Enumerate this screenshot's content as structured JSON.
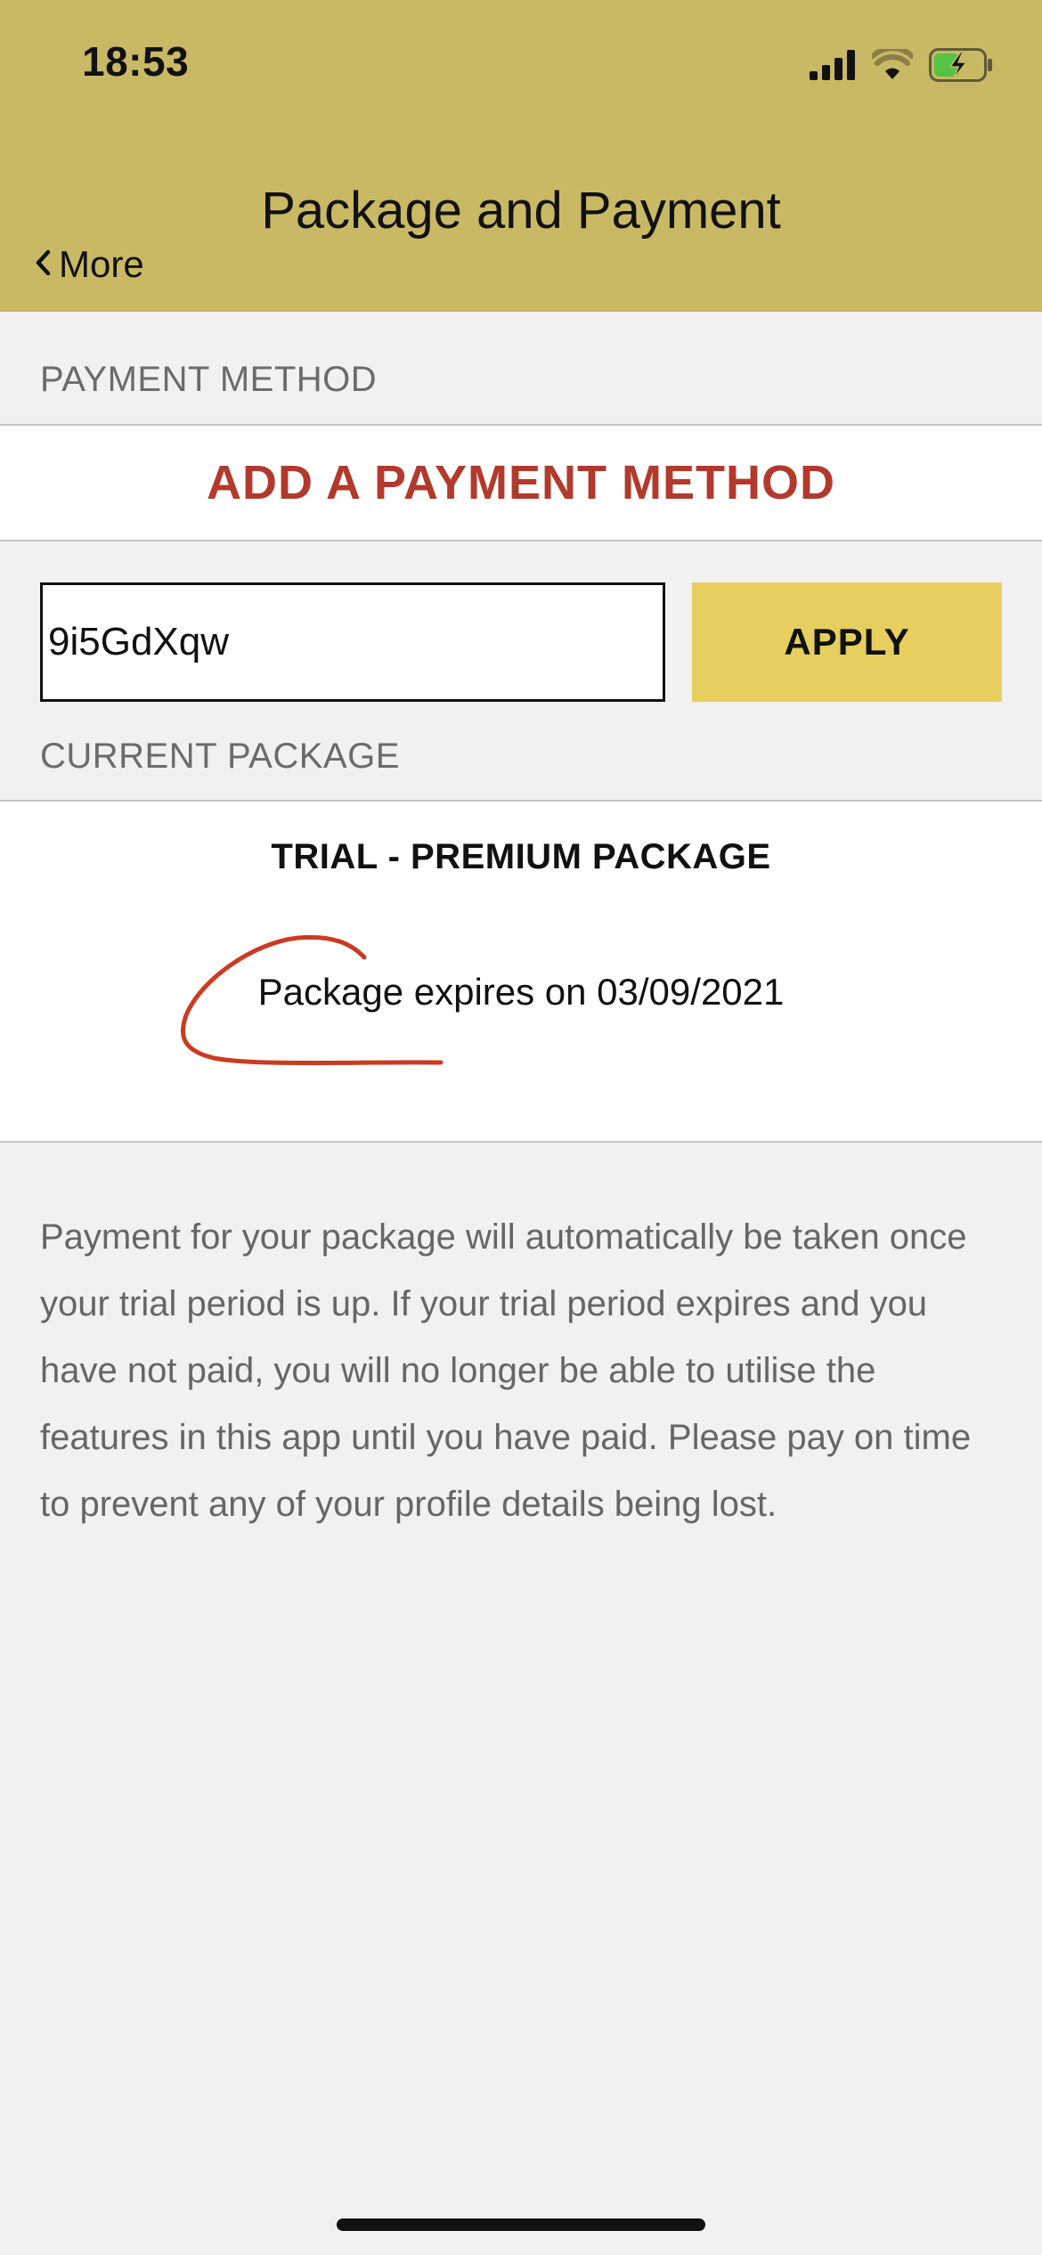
{
  "status_bar": {
    "time": "18:53",
    "icons": [
      "signal-icon",
      "wifi-icon",
      "battery-charging-icon"
    ]
  },
  "nav": {
    "title": "Package and Payment",
    "back_label": "More"
  },
  "payment": {
    "section_label": "PAYMENT METHOD",
    "add_label": "ADD A PAYMENT METHOD",
    "promo_code_value": "9i5GdXqw",
    "apply_label": "APPLY"
  },
  "package": {
    "section_label": "CURRENT PACKAGE",
    "name": "TRIAL - PREMIUM PACKAGE",
    "expiry": "Package expires on 03/09/2021"
  },
  "info": {
    "text": "Payment for your package will automatically be taken once your trial period is up. If your trial period expires and you have not paid, you will no longer be able to utilise the features in this app until you have paid. Please pay on time to prevent any of your profile details being lost."
  },
  "colors": {
    "header": "#c9b964",
    "accent_red": "#b23a2c",
    "apply_button": "#e6cf5e",
    "background": "#f1f1f1"
  }
}
